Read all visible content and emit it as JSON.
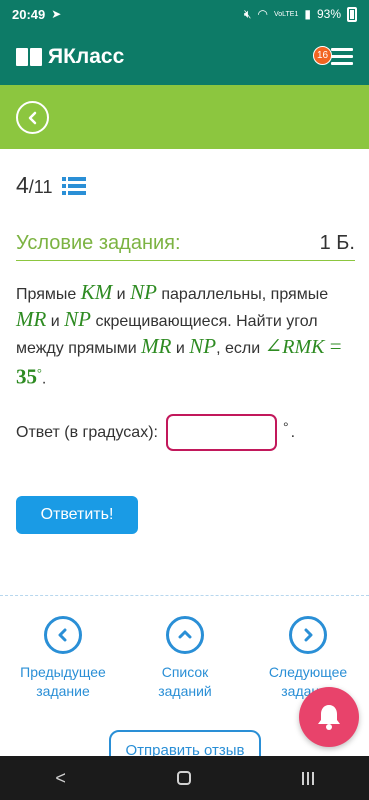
{
  "status_bar": {
    "time": "20:49",
    "signal_label": "VoLTE1",
    "battery": "93%"
  },
  "app_bar": {
    "logo_text": "ЯКласс",
    "notifications_count": "16"
  },
  "task_counter": {
    "current": "4",
    "total": "/11"
  },
  "condition": {
    "title": "Условие задания:",
    "points": "1 Б."
  },
  "task_text": {
    "p1": "Прямые ",
    "km": "KM",
    "and1": " и ",
    "np1": "NP",
    "p2": " параллельны, прямые ",
    "mr1": "MR",
    "and2": " и ",
    "np2": "NP",
    "p3": " скрещивающиеся. Найти угол между прямыми ",
    "mr2": "MR",
    "and3": " и ",
    "np3": "NP",
    "p4": ", если ",
    "angle_sym": "∠",
    "angle_name": "RMK",
    "eq": " = ",
    "angle_value": "35",
    "deg": "°",
    "end": "."
  },
  "answer": {
    "label": "Ответ (в градусах):",
    "value": "",
    "unit": "°",
    "dot": "."
  },
  "submit_label": "Ответить!",
  "bottom_nav": {
    "prev": "Предыдущее задание",
    "list": "Список заданий",
    "next": "Следующее задание"
  },
  "feedback_label": "Отправить отзыв",
  "colors": {
    "header": "#0d7b67",
    "accent_green": "#8cc63f",
    "link_blue": "#2a8fd6",
    "input_border": "#c2185b",
    "bell": "#e8436b"
  }
}
